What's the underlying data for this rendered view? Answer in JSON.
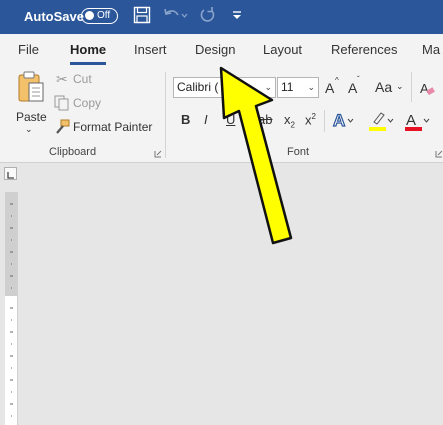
{
  "titlebar": {
    "autosave_label": "AutoSave",
    "toggle_state": "Off",
    "icons": [
      "save-icon",
      "undo-icon",
      "redo-icon",
      "customize-quick-access-icon"
    ],
    "bg_color": "#2b579a"
  },
  "tabs": [
    {
      "label": "File",
      "active": false
    },
    {
      "label": "Home",
      "active": true
    },
    {
      "label": "Insert",
      "active": false
    },
    {
      "label": "Design",
      "active": false
    },
    {
      "label": "Layout",
      "active": false
    },
    {
      "label": "References",
      "active": false
    },
    {
      "label": "Ma",
      "active": false
    }
  ],
  "clipboard": {
    "paste_label": "Paste",
    "cut_label": "Cut",
    "copy_label": "Copy",
    "format_painter_label": "Format Painter",
    "group_label": "Clipboard"
  },
  "font": {
    "font_name": "Calibri (",
    "font_size": "11",
    "grow_label": "A",
    "shrink_label": "A",
    "case_label": "Aa",
    "bold_label": "B",
    "italic_label": "I",
    "underline_label": "U",
    "strike_label": "ab",
    "subscript_label": "x",
    "superscript_label": "x",
    "group_label": "Font",
    "highlight_color": "#ffff00",
    "font_color": "#e81123"
  },
  "annotation": {
    "arrow_color": "#ffff00"
  }
}
